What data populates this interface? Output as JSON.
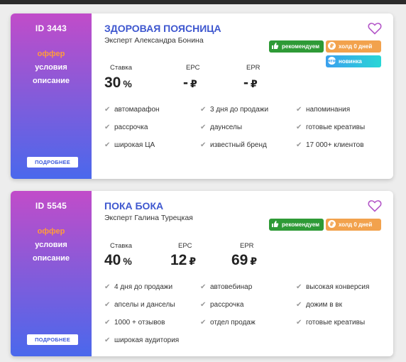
{
  "cards": [
    {
      "id_label": "ID 3443",
      "offer": "оффер",
      "terms": "условия",
      "description": "описание",
      "more_button": "ПОДРОБНЕЕ",
      "title": "ЗДОРОВАЯ ПОЯСНИЦА",
      "expert": "Эксперт Александра Бонина",
      "badges": {
        "recommend": "рекомендуем",
        "hold": "холд 0 дней",
        "new": "новинка"
      },
      "stats": {
        "rate_label": "Ставка",
        "rate_value": "30",
        "rate_unit": "%",
        "epc_label": "EPC",
        "epc_value": "-",
        "epc_unit": "₽",
        "epr_label": "EPR",
        "epr_value": "-",
        "epr_unit": "₽"
      },
      "features": [
        "автомарафон",
        "3 дня до продажи",
        "напоминания",
        "рассрочка",
        "даунселы",
        "готовые креативы",
        "широкая ЦА",
        "известный бренд",
        "17 000+ клиентов"
      ]
    },
    {
      "id_label": "ID 5545",
      "offer": "оффер",
      "terms": "условия",
      "description": "описание",
      "more_button": "ПОДРОБНЕЕ",
      "title": "ПОКА БОКА",
      "expert": "Эксперт Галина Турецкая",
      "badges": {
        "recommend": "рекомендуем",
        "hold": "холд 0 дней"
      },
      "stats": {
        "rate_label": "Ставка",
        "rate_value": "40",
        "rate_unit": "%",
        "epc_label": "EPC",
        "epc_value": "12",
        "epc_unit": "₽",
        "epr_label": "EPR",
        "epr_value": "69",
        "epr_unit": "₽"
      },
      "features": [
        "4 дня до продажи",
        "автовебинар",
        "высокая конверсия",
        "апселы и данселы",
        "рассрочка",
        "дожим в вк",
        "1000 + отзывов",
        "отдел продаж",
        "готовые креативы",
        "широкая аудитория"
      ]
    }
  ],
  "colors": {
    "accent": "#3e57cf",
    "offer": "#ff9c3b",
    "recommend": "#2e9a36",
    "hold": "#f2a24d",
    "new": "#28d6d6",
    "heart": "#b356c8"
  }
}
